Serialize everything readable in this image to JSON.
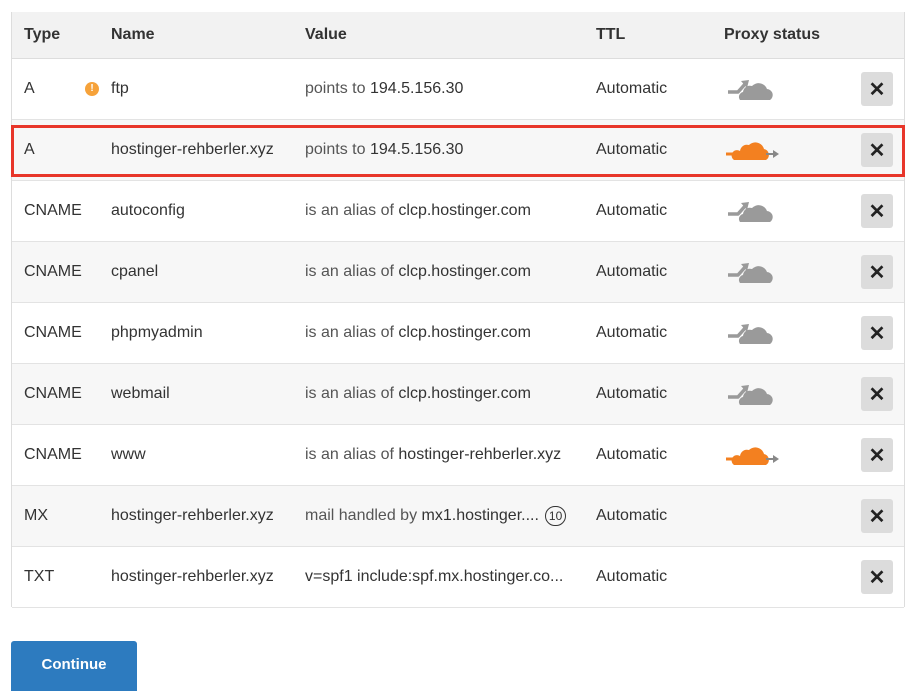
{
  "columns": {
    "type": "Type",
    "name": "Name",
    "value": "Value",
    "ttl": "TTL",
    "proxy": "Proxy status"
  },
  "records": [
    {
      "type": "A",
      "name": "ftp",
      "value_prefix": "points to",
      "value": "194.5.156.30",
      "ttl": "Automatic",
      "proxy": "dns-only",
      "warning_icon": "info-warning-icon"
    },
    {
      "type": "A",
      "name": "hostinger-rehberler.xyz",
      "value_prefix": "points to",
      "value": "194.5.156.30",
      "ttl": "Automatic",
      "proxy": "proxied",
      "highlighted": true
    },
    {
      "type": "CNAME",
      "name": "autoconfig",
      "value_prefix": "is an alias of",
      "value": "clcp.hostinger.com",
      "ttl": "Automatic",
      "proxy": "dns-only"
    },
    {
      "type": "CNAME",
      "name": "cpanel",
      "value_prefix": "is an alias of",
      "value": "clcp.hostinger.com",
      "ttl": "Automatic",
      "proxy": "dns-only"
    },
    {
      "type": "CNAME",
      "name": "phpmyadmin",
      "value_prefix": "is an alias of",
      "value": "clcp.hostinger.com",
      "ttl": "Automatic",
      "proxy": "dns-only"
    },
    {
      "type": "CNAME",
      "name": "webmail",
      "value_prefix": "is an alias of",
      "value": "clcp.hostinger.com",
      "ttl": "Automatic",
      "proxy": "dns-only"
    },
    {
      "type": "CNAME",
      "name": "www",
      "value_prefix": "is an alias of",
      "value": "hostinger-rehberler.xyz",
      "ttl": "Automatic",
      "proxy": "proxied"
    },
    {
      "type": "MX",
      "name": "hostinger-rehberler.xyz",
      "value_prefix": "mail handled by",
      "value": "mx1.hostinger....",
      "priority": "10",
      "ttl": "Automatic",
      "proxy": "none"
    },
    {
      "type": "TXT",
      "name": "hostinger-rehberler.xyz",
      "value_prefix": "",
      "value": "v=spf1 include:spf.mx.hostinger.co...",
      "ttl": "Automatic",
      "proxy": "none"
    }
  ],
  "delete_label": "✕",
  "continue_label": "Continue",
  "colors": {
    "proxied": "#f38020",
    "dns_only": "#9a9a9a",
    "highlight": "#e8362a",
    "button": "#2d7bbf"
  }
}
